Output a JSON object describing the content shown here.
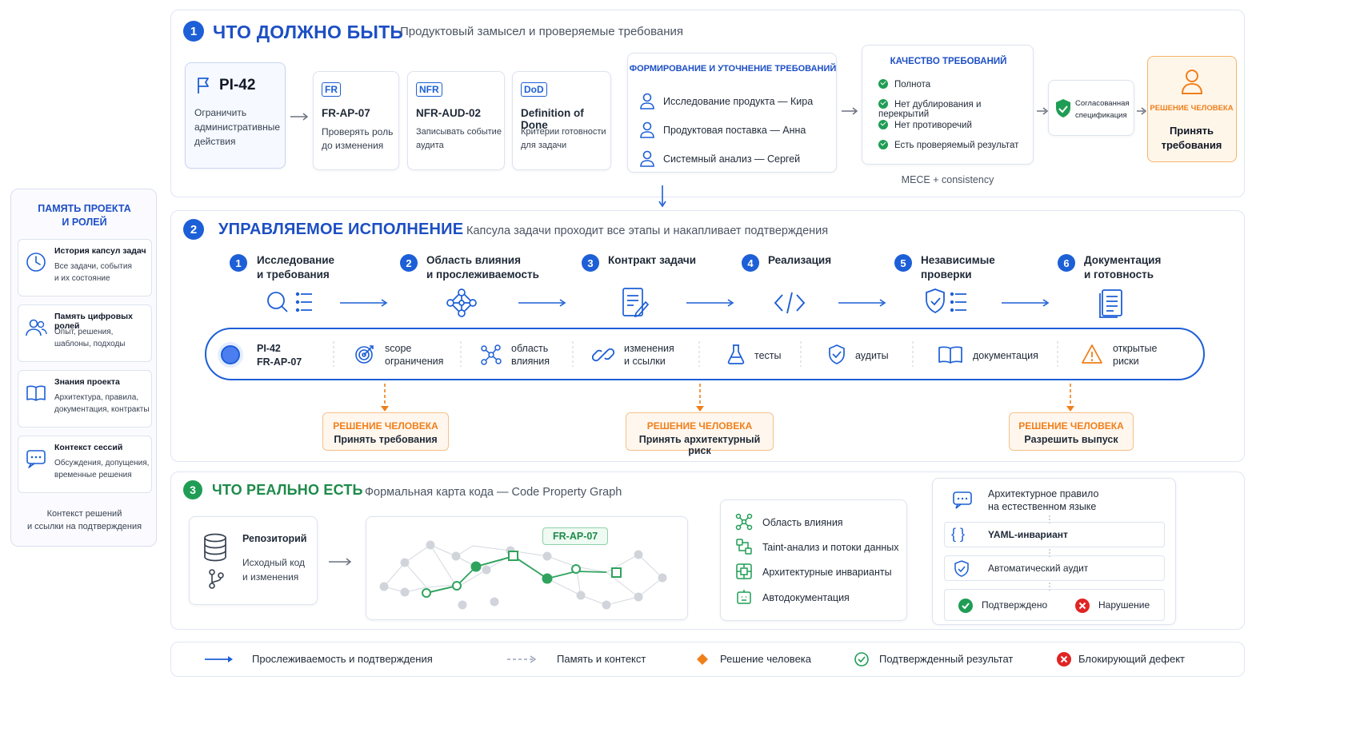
{
  "colors": {
    "primary_blue": "#1d5fd6",
    "green": "#1f9d55",
    "orange": "#f07f1b",
    "red": "#e02424"
  },
  "memory": {
    "title_line1": "ПАМЯТЬ ПРОЕКТА",
    "title_line2": "И РОЛЕЙ",
    "cards": [
      {
        "icon": "clock-icon",
        "title": "История капсул задач",
        "desc1": "Все задачи, события",
        "desc2": "и их состояние"
      },
      {
        "icon": "users-icon",
        "title": "Память цифровых ролей",
        "desc1": "Опыт, решения,",
        "desc2": "шаблоны, подходы"
      },
      {
        "icon": "book-icon",
        "title": "Знания проекта",
        "desc1": "Архитектура, правила,",
        "desc2": "документация, контракты"
      },
      {
        "icon": "chat-icon",
        "title": "Контекст сессий",
        "desc1": "Обсуждения, допущения,",
        "desc2": "временные решения"
      }
    ],
    "footer1": "Контекст решений",
    "footer2": "и ссылки на подтверждения"
  },
  "section1": {
    "num": "1",
    "title": "ЧТО ДОЛЖНО БЫТЬ",
    "subtitle": "Продуктовый замысел и проверяемые требования",
    "pi": {
      "id": "PI-42",
      "desc1": "Ограничить",
      "desc2": "административные",
      "desc3": "действия"
    },
    "fr": {
      "tag": "FR",
      "id": "FR-AP-07",
      "desc1": "Проверять роль",
      "desc2": "до изменения"
    },
    "nfr": {
      "tag": "NFR",
      "id": "NFR-AUD-02",
      "desc1": "Записывать событие",
      "desc2": "аудита"
    },
    "dod": {
      "tag": "DoD",
      "id": "Definition of Done",
      "desc1": "Критерии готовности",
      "desc2": "для задачи"
    },
    "forming": {
      "title": "ФОРМИРОВАНИЕ И УТОЧНЕНИЕ ТРЕБОВАНИЙ",
      "people": [
        "Исследование продукта — Кира",
        "Продуктовая поставка — Анна",
        "Системный анализ — Сергей"
      ]
    },
    "quality": {
      "title": "КАЧЕСТВО ТРЕБОВАНИЙ",
      "checks": [
        "Полнота",
        "Нет дублирования и перекрытий",
        "Нет противоречий",
        "Есть проверяемый результат"
      ],
      "footer": "MECE + consistency"
    },
    "agreed": {
      "line1": "Согласованная",
      "line2": "спецификация"
    },
    "decision": {
      "head": "РЕШЕНИЕ ЧЕЛОВЕКА",
      "line1": "Принять",
      "line2": "требования"
    }
  },
  "section2": {
    "num": "2",
    "title": "УПРАВЛЯЕМОЕ ИСПОЛНЕНИЕ",
    "subtitle": "Капсула задачи проходит все этапы и накапливает подтверждения",
    "stages": [
      {
        "num": "1",
        "line1": "Исследование",
        "line2": "и требования"
      },
      {
        "num": "2",
        "line1": "Область влияния",
        "line2": "и прослеживаемость"
      },
      {
        "num": "3",
        "line1": "Контракт задачи",
        "line2": ""
      },
      {
        "num": "4",
        "line1": "Реализация",
        "line2": ""
      },
      {
        "num": "5",
        "line1": "Независимые",
        "line2": "проверки"
      },
      {
        "num": "6",
        "line1": "Документация",
        "line2": "и готовность"
      }
    ],
    "capsule": {
      "id1": "PI-42",
      "id2": "FR-AP-07",
      "items": [
        {
          "icon": "target-icon",
          "line1": "scope",
          "line2": "ограничения"
        },
        {
          "icon": "network-icon",
          "line1": "область",
          "line2": "влияния"
        },
        {
          "icon": "link-icon",
          "line1": "изменения",
          "line2": "и ссылки"
        },
        {
          "icon": "flask-icon",
          "line1": "тесты",
          "line2": ""
        },
        {
          "icon": "shield-check-icon",
          "line1": "аудиты",
          "line2": ""
        },
        {
          "icon": "book-icon",
          "line1": "документация",
          "line2": ""
        },
        {
          "icon": "warning-icon",
          "line1": "открытые",
          "line2": "риски"
        }
      ]
    },
    "decisions": [
      {
        "head": "РЕШЕНИЕ ЧЕЛОВЕКА",
        "body": "Принять требования"
      },
      {
        "head": "РЕШЕНИЕ ЧЕЛОВЕКА",
        "body": "Принять архитектурный риск"
      },
      {
        "head": "РЕШЕНИЕ ЧЕЛОВЕКА",
        "body": "Разрешить выпуск"
      }
    ]
  },
  "section3": {
    "num": "3",
    "title": "ЧТО РЕАЛЬНО ЕСТЬ",
    "subtitle": "Формальная карта кода — Code Property Graph",
    "repo": {
      "title": "Репозиторий",
      "line1": "Исходный код",
      "line2": "и изменения"
    },
    "graph_label": "FR-AP-07",
    "cpg_features": [
      "Область влияния",
      "Taint-анализ и потоки данных",
      "Архитектурные инварианты",
      "Автодокументация"
    ],
    "rule": {
      "line1": "Архитектурное правило",
      "line2": "на естественном языке",
      "yaml": "YAML-инвариант",
      "audit": "Автоматический аудит",
      "ok": "Подтверждено",
      "bad": "Нарушение"
    }
  },
  "legend": {
    "trace": "Прослеживаемость и подтверждения",
    "memory": "Память и контекст",
    "decision": "Решение человека",
    "confirmed": "Подтвержденный результат",
    "blocking": "Блокирующий дефект"
  }
}
